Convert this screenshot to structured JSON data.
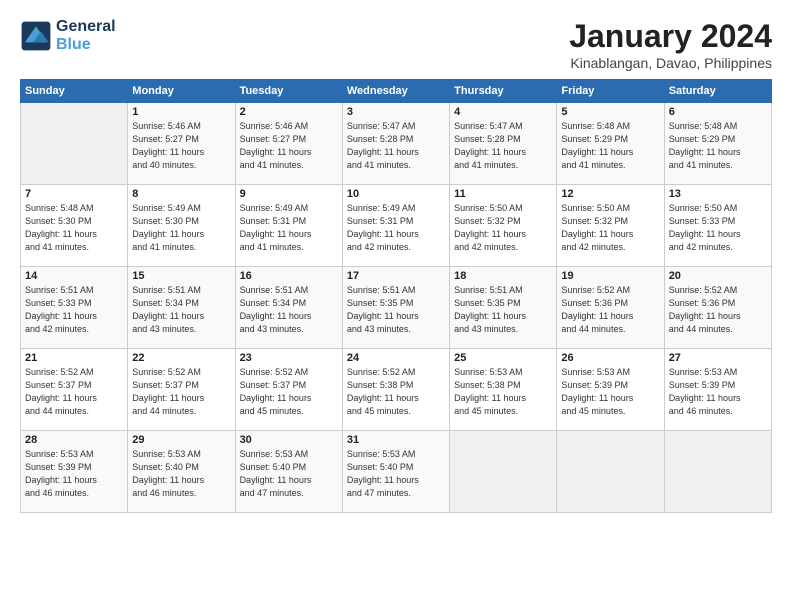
{
  "header": {
    "logo_general": "General",
    "logo_blue": "Blue",
    "month_title": "January 2024",
    "location": "Kinablangan, Davao, Philippines"
  },
  "weekdays": [
    "Sunday",
    "Monday",
    "Tuesday",
    "Wednesday",
    "Thursday",
    "Friday",
    "Saturday"
  ],
  "weeks": [
    [
      {
        "day": "",
        "info": ""
      },
      {
        "day": "1",
        "info": "Sunrise: 5:46 AM\nSunset: 5:27 PM\nDaylight: 11 hours\nand 40 minutes."
      },
      {
        "day": "2",
        "info": "Sunrise: 5:46 AM\nSunset: 5:27 PM\nDaylight: 11 hours\nand 41 minutes."
      },
      {
        "day": "3",
        "info": "Sunrise: 5:47 AM\nSunset: 5:28 PM\nDaylight: 11 hours\nand 41 minutes."
      },
      {
        "day": "4",
        "info": "Sunrise: 5:47 AM\nSunset: 5:28 PM\nDaylight: 11 hours\nand 41 minutes."
      },
      {
        "day": "5",
        "info": "Sunrise: 5:48 AM\nSunset: 5:29 PM\nDaylight: 11 hours\nand 41 minutes."
      },
      {
        "day": "6",
        "info": "Sunrise: 5:48 AM\nSunset: 5:29 PM\nDaylight: 11 hours\nand 41 minutes."
      }
    ],
    [
      {
        "day": "7",
        "info": "Sunrise: 5:48 AM\nSunset: 5:30 PM\nDaylight: 11 hours\nand 41 minutes."
      },
      {
        "day": "8",
        "info": "Sunrise: 5:49 AM\nSunset: 5:30 PM\nDaylight: 11 hours\nand 41 minutes."
      },
      {
        "day": "9",
        "info": "Sunrise: 5:49 AM\nSunset: 5:31 PM\nDaylight: 11 hours\nand 41 minutes."
      },
      {
        "day": "10",
        "info": "Sunrise: 5:49 AM\nSunset: 5:31 PM\nDaylight: 11 hours\nand 42 minutes."
      },
      {
        "day": "11",
        "info": "Sunrise: 5:50 AM\nSunset: 5:32 PM\nDaylight: 11 hours\nand 42 minutes."
      },
      {
        "day": "12",
        "info": "Sunrise: 5:50 AM\nSunset: 5:32 PM\nDaylight: 11 hours\nand 42 minutes."
      },
      {
        "day": "13",
        "info": "Sunrise: 5:50 AM\nSunset: 5:33 PM\nDaylight: 11 hours\nand 42 minutes."
      }
    ],
    [
      {
        "day": "14",
        "info": "Sunrise: 5:51 AM\nSunset: 5:33 PM\nDaylight: 11 hours\nand 42 minutes."
      },
      {
        "day": "15",
        "info": "Sunrise: 5:51 AM\nSunset: 5:34 PM\nDaylight: 11 hours\nand 43 minutes."
      },
      {
        "day": "16",
        "info": "Sunrise: 5:51 AM\nSunset: 5:34 PM\nDaylight: 11 hours\nand 43 minutes."
      },
      {
        "day": "17",
        "info": "Sunrise: 5:51 AM\nSunset: 5:35 PM\nDaylight: 11 hours\nand 43 minutes."
      },
      {
        "day": "18",
        "info": "Sunrise: 5:51 AM\nSunset: 5:35 PM\nDaylight: 11 hours\nand 43 minutes."
      },
      {
        "day": "19",
        "info": "Sunrise: 5:52 AM\nSunset: 5:36 PM\nDaylight: 11 hours\nand 44 minutes."
      },
      {
        "day": "20",
        "info": "Sunrise: 5:52 AM\nSunset: 5:36 PM\nDaylight: 11 hours\nand 44 minutes."
      }
    ],
    [
      {
        "day": "21",
        "info": "Sunrise: 5:52 AM\nSunset: 5:37 PM\nDaylight: 11 hours\nand 44 minutes."
      },
      {
        "day": "22",
        "info": "Sunrise: 5:52 AM\nSunset: 5:37 PM\nDaylight: 11 hours\nand 44 minutes."
      },
      {
        "day": "23",
        "info": "Sunrise: 5:52 AM\nSunset: 5:37 PM\nDaylight: 11 hours\nand 45 minutes."
      },
      {
        "day": "24",
        "info": "Sunrise: 5:52 AM\nSunset: 5:38 PM\nDaylight: 11 hours\nand 45 minutes."
      },
      {
        "day": "25",
        "info": "Sunrise: 5:53 AM\nSunset: 5:38 PM\nDaylight: 11 hours\nand 45 minutes."
      },
      {
        "day": "26",
        "info": "Sunrise: 5:53 AM\nSunset: 5:39 PM\nDaylight: 11 hours\nand 45 minutes."
      },
      {
        "day": "27",
        "info": "Sunrise: 5:53 AM\nSunset: 5:39 PM\nDaylight: 11 hours\nand 46 minutes."
      }
    ],
    [
      {
        "day": "28",
        "info": "Sunrise: 5:53 AM\nSunset: 5:39 PM\nDaylight: 11 hours\nand 46 minutes."
      },
      {
        "day": "29",
        "info": "Sunrise: 5:53 AM\nSunset: 5:40 PM\nDaylight: 11 hours\nand 46 minutes."
      },
      {
        "day": "30",
        "info": "Sunrise: 5:53 AM\nSunset: 5:40 PM\nDaylight: 11 hours\nand 47 minutes."
      },
      {
        "day": "31",
        "info": "Sunrise: 5:53 AM\nSunset: 5:40 PM\nDaylight: 11 hours\nand 47 minutes."
      },
      {
        "day": "",
        "info": ""
      },
      {
        "day": "",
        "info": ""
      },
      {
        "day": "",
        "info": ""
      }
    ]
  ]
}
